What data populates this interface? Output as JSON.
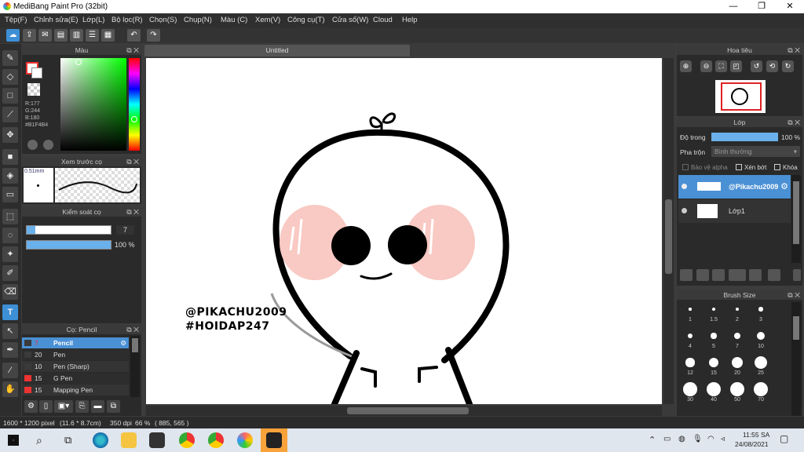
{
  "window": {
    "title": "MediBang Paint Pro (32bit)",
    "minimize": "—",
    "maximize": "❐",
    "close": "✕"
  },
  "menu": [
    "Tệp(F)",
    "Chỉnh sửa(E)",
    "Lớp(L)",
    "Bộ lọc(R)",
    "Chọn(S)",
    "Chụp(N)",
    "Màu (C)",
    "Xem(V)",
    "Công cụ(T)",
    "Cửa sổ(W)",
    "Cloud",
    "Help"
  ],
  "toolbar": {
    "undo": "↶",
    "redo": "↷"
  },
  "color_panel": {
    "title": "Màu",
    "r": "R:177",
    "g": "G:244",
    "b": "B:180",
    "hex": "#B1F4B4",
    "fg": "#ffffff",
    "bg": "#ffffff"
  },
  "brush_preview": {
    "title": "Xem trước cọ",
    "size": "0.51mm"
  },
  "brush_control": {
    "title": "Kiểm soát cọ",
    "size_value": "7",
    "opacity_value": "100 %",
    "opacity": 1.0
  },
  "brush_list": {
    "title": "Cọ: Pencil",
    "items": [
      {
        "size": "7",
        "name": "Pencil",
        "color": "#3a3a3a",
        "selected": true
      },
      {
        "size": "20",
        "name": "Pen",
        "color": "#3a3a3a",
        "selected": false
      },
      {
        "size": "10",
        "name": "Pen (Sharp)",
        "color": "#3a3a3a",
        "selected": false
      },
      {
        "size": "15",
        "name": "G Pen",
        "color": "#e33",
        "selected": false
      },
      {
        "size": "15",
        "name": "Mapping Pen",
        "color": "#e33",
        "selected": false
      }
    ]
  },
  "document": {
    "tab": "Untitled",
    "watermark1": "@PIKACHU2009",
    "watermark2": "#HOIDAP247"
  },
  "navigator": {
    "title": "Hoa tiêu"
  },
  "layers": {
    "title": "Lớp",
    "opacity_label": "Độ trong",
    "opacity_value": "100 %",
    "opacity": 1.0,
    "blend_label": "Pha trộn",
    "blend_value": "Bình thường",
    "protect_alpha": "Bảo vệ alpha",
    "clipping": "Xén bớt",
    "lock": "Khóa",
    "items": [
      {
        "name": "@Pikachu2009",
        "selected": true
      },
      {
        "name": "Lớp1",
        "selected": false
      }
    ]
  },
  "brush_size": {
    "title": "Brush Size",
    "values": [
      "1",
      "1.5",
      "2",
      "3",
      "4",
      "5",
      "7",
      "10",
      "12",
      "15",
      "20",
      "25",
      "30",
      "40",
      "50",
      "70"
    ]
  },
  "status": {
    "size": "1600 * 1200 pixel",
    "cm": "(11.6 * 8.7cm)",
    "dpi": "350 dpi",
    "zoom": "66 %",
    "coords": "( 885, 565 )"
  },
  "taskbar": {
    "time": "11:55 SA",
    "date": "24/08/2021"
  }
}
